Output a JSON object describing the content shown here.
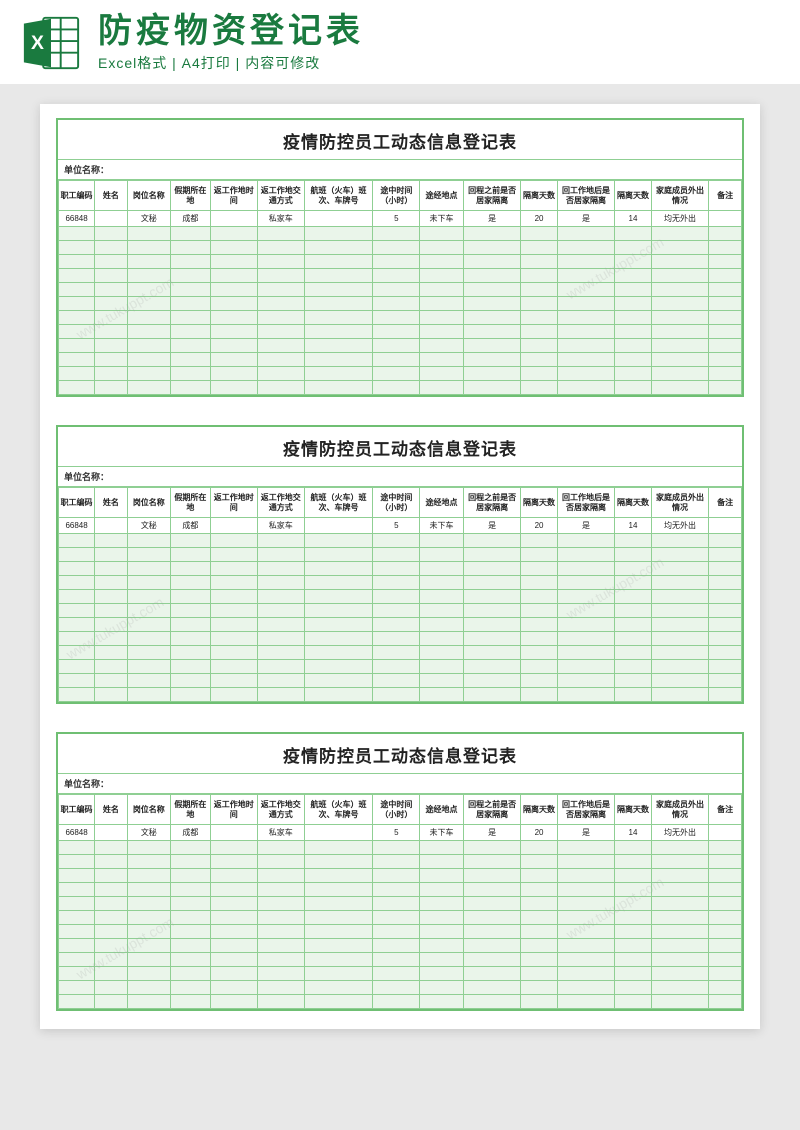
{
  "header": {
    "title": "防疫物资登记表",
    "subtitle": "Excel格式 | A4打印 | 内容可修改",
    "icon_name": "excel-icon"
  },
  "sheet": {
    "title": "疫情防控员工动态信息登记表",
    "unit_label": "单位名称：",
    "columns": [
      "职工编码",
      "姓名",
      "岗位名称",
      "假期所在地",
      "返工作地时间",
      "返工作地交通方式",
      "航班（火车）班次、车牌号",
      "途中时间（小时）",
      "途经地点",
      "回程之前是否居家隔离",
      "隔离天数",
      "回工作地后是否居家隔离",
      "隔离天数",
      "家庭成员外出情况",
      "备注"
    ],
    "data_row": [
      "66848",
      "",
      "文秘",
      "成都",
      "",
      "私家车",
      "",
      "5",
      "未下车",
      "是",
      "20",
      "是",
      "14",
      "均无外出",
      ""
    ],
    "empty_rows": 12,
    "repeat": 3
  },
  "watermark": "www.tukuppt.com"
}
